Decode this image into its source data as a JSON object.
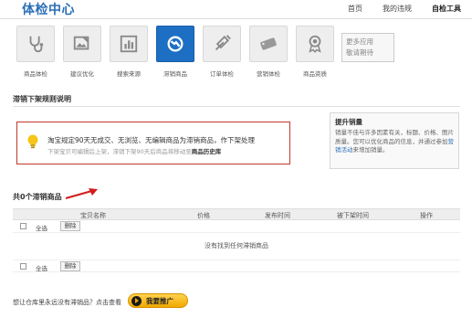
{
  "header": {
    "title": "体检中心",
    "nav": [
      "首页",
      "我的违规",
      "自检工具"
    ],
    "nav_active": "自检工具"
  },
  "toolbar": {
    "items": [
      {
        "label": "商品体检",
        "icon": "stethoscope-icon"
      },
      {
        "label": "建议优化",
        "icon": "image-edit-icon"
      },
      {
        "label": "搜索来源",
        "icon": "bar-chart-icon"
      },
      {
        "label": "滞销商品",
        "icon": "no-sales-icon",
        "active": true
      },
      {
        "label": "订单体检",
        "icon": "syringe-icon"
      },
      {
        "label": "营销体检",
        "icon": "sale-tag-icon"
      },
      {
        "label": "商品资质",
        "icon": "award-ribbon-icon"
      }
    ],
    "more": {
      "line1": "更多应用",
      "line2": "敬请期待"
    },
    "active_color": "#1d6fc4"
  },
  "rules": {
    "section_title": "滞销下架规则说明",
    "notice_main": "淘宝规定90天无成交、无浏览、无编辑商品为滞销商品，作下架处理",
    "notice_sub": "下架宝贝可编辑后上架，滞销下架90天后商品将移动至",
    "notice_sub_link": "商品历史库",
    "border_color": "#c0392b"
  },
  "side_tip": {
    "title": "提升销量",
    "text": "销量不佳与许多因素有关，标题、价格、图片质量。您可以优化商品的信息，并通过参加",
    "link": "营销活动",
    "text_end": "来增加销量。"
  },
  "products": {
    "count_title": "共0个滞销商品",
    "columns": [
      "宝贝名称",
      "价格",
      "发布时间",
      "被下架时间",
      "操作"
    ],
    "select_all": "全选",
    "delete": "删除",
    "empty_message": "没有找到任何滞销商品"
  },
  "footer": {
    "question": "想让仓库里永远没有滞销品？点击查看",
    "promo_button": "我要推广",
    "promo_color": "#f0a800"
  }
}
